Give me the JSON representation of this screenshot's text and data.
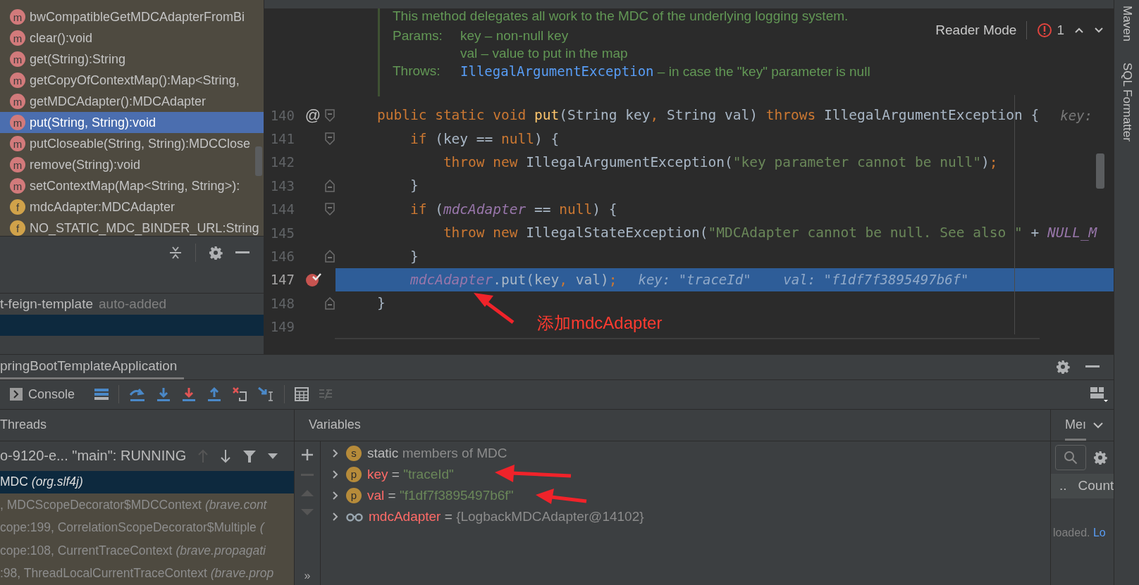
{
  "structure": {
    "items": [
      {
        "kind": "method",
        "badge": "m",
        "label": "bwCompatibleGetMDCAdapterFromBi",
        "selected": false
      },
      {
        "kind": "method",
        "badge": "m",
        "label": "clear():void",
        "selected": false
      },
      {
        "kind": "method",
        "badge": "m",
        "label": "get(String):String",
        "selected": false
      },
      {
        "kind": "method",
        "badge": "m",
        "label": "getCopyOfContextMap():Map<String,",
        "selected": false
      },
      {
        "kind": "method",
        "badge": "m",
        "label": "getMDCAdapter():MDCAdapter",
        "selected": false
      },
      {
        "kind": "method",
        "badge": "m",
        "label": "put(String, String):void",
        "selected": true
      },
      {
        "kind": "method",
        "badge": "m",
        "label": "putCloseable(String, String):MDCClose",
        "selected": false
      },
      {
        "kind": "method",
        "badge": "m",
        "label": "remove(String):void",
        "selected": false
      },
      {
        "kind": "method",
        "badge": "m",
        "label": "setContextMap(Map<String, String>):",
        "selected": false
      },
      {
        "kind": "field",
        "badge": "f",
        "label": "mdcAdapter:MDCAdapter",
        "selected": false
      },
      {
        "kind": "field",
        "badge": "f",
        "label": "NO_STATIC_MDC_BINDER_URL:String",
        "selected": false
      }
    ]
  },
  "dependency": {
    "module": "t-feign-template",
    "note": "auto-added"
  },
  "editor": {
    "doc": {
      "summary": "This method delegates all work to the MDC of the underlying logging system.",
      "params_label": "Params:",
      "params": [
        "key – non-null key",
        "val – value to put in the map"
      ],
      "throws_label": "Throws:",
      "throws_type": "IllegalArgumentException",
      "throws_text": "– in case the \"key\" parameter is null"
    },
    "reader_mode": "Reader Mode",
    "problems": "1",
    "lines": [
      {
        "number": "140",
        "mark": "@",
        "breakpoint": false,
        "current": false,
        "fold_open": true,
        "fold_close": false,
        "tokens": [
          {
            "kind": "kw",
            "s": "    public static void "
          },
          {
            "kind": "method",
            "s": "put"
          },
          {
            "kind": "plain",
            "s": "(String key"
          },
          {
            "kind": "kw",
            "s": ", "
          },
          {
            "kind": "plain",
            "s": "String val) "
          },
          {
            "kind": "kw",
            "s": "throws "
          },
          {
            "kind": "plain",
            "s": "IllegalArgumentException {"
          }
        ],
        "hint": "key:"
      },
      {
        "number": "141",
        "breakpoint": false,
        "current": false,
        "fold_open": true,
        "fold_close": false,
        "tokens": [
          {
            "kind": "kw",
            "s": "        if "
          },
          {
            "kind": "plain",
            "s": "(key == "
          },
          {
            "kind": "kw",
            "s": "null"
          },
          {
            "kind": "plain",
            "s": ") {"
          }
        ]
      },
      {
        "number": "142",
        "breakpoint": false,
        "current": false,
        "fold_open": false,
        "fold_close": false,
        "tokens": [
          {
            "kind": "kw",
            "s": "            throw new "
          },
          {
            "kind": "plain",
            "s": "IllegalArgumentException("
          },
          {
            "kind": "str",
            "s": "\"key parameter cannot be null\""
          },
          {
            "kind": "plain",
            "s": ")"
          },
          {
            "kind": "kw",
            "s": ";"
          }
        ]
      },
      {
        "number": "143",
        "breakpoint": false,
        "current": false,
        "fold_open": false,
        "fold_close": true,
        "tokens": [
          {
            "kind": "plain",
            "s": "        }"
          }
        ]
      },
      {
        "number": "144",
        "breakpoint": false,
        "current": false,
        "fold_open": true,
        "fold_close": false,
        "tokens": [
          {
            "kind": "kw",
            "s": "        if "
          },
          {
            "kind": "plain",
            "s": "("
          },
          {
            "kind": "field",
            "s": "mdcAdapter"
          },
          {
            "kind": "plain",
            "s": " == "
          },
          {
            "kind": "kw",
            "s": "null"
          },
          {
            "kind": "plain",
            "s": ") {"
          }
        ]
      },
      {
        "number": "145",
        "breakpoint": false,
        "current": false,
        "fold_open": false,
        "fold_close": false,
        "tokens": [
          {
            "kind": "kw",
            "s": "            throw new "
          },
          {
            "kind": "plain",
            "s": "IllegalStateException("
          },
          {
            "kind": "str",
            "s": "\"MDCAdapter cannot be null. See also \""
          },
          {
            "kind": "plain",
            "s": " + "
          },
          {
            "kind": "field",
            "s": "NULL_M"
          }
        ]
      },
      {
        "number": "146",
        "breakpoint": false,
        "current": false,
        "fold_open": false,
        "fold_close": true,
        "tokens": [
          {
            "kind": "plain",
            "s": "        }"
          }
        ]
      },
      {
        "number": "147",
        "breakpoint": true,
        "current": true,
        "fold_open": false,
        "fold_close": false,
        "tokens": [
          {
            "kind": "field",
            "s": "        mdcAdapter"
          },
          {
            "kind": "plain",
            "s": ".put(key"
          },
          {
            "kind": "kw",
            "s": ", "
          },
          {
            "kind": "plain",
            "s": "val)"
          },
          {
            "kind": "kw",
            "s": ";"
          }
        ],
        "hint": "key: \"traceId\"    val: \"f1df7f3895497b6f\""
      },
      {
        "number": "148",
        "breakpoint": false,
        "current": false,
        "fold_open": false,
        "fold_close": true,
        "tokens": [
          {
            "kind": "plain",
            "s": "    }"
          }
        ]
      },
      {
        "number": "149",
        "breakpoint": false,
        "current": false,
        "fold_open": false,
        "fold_close": false
      }
    ],
    "annotation": "添加mdcAdapter"
  },
  "debug": {
    "title": "pringBootTemplateApplication",
    "console_tab": "Console",
    "threads": {
      "title": "Threads",
      "thread": "o-9120-e... \"main\": RUNNING",
      "frames": [
        {
          "text": "MDC",
          "detail": "(org.slf4j)",
          "selected": true
        },
        {
          "text": ", MDCScopeDecorator$MDCContext",
          "detail": "(brave.cont",
          "selected": false
        },
        {
          "text": "cope:199, CorrelationScopeDecorator$Multiple",
          "detail": "(",
          "selected": false
        },
        {
          "text": "cope:108, CurrentTraceContext",
          "detail": "(brave.propagati",
          "selected": false
        },
        {
          "text": ":98, ThreadLocalCurrentTraceContext",
          "detail": "(brave.prop",
          "selected": false
        }
      ]
    },
    "variables": {
      "title": "Variables",
      "items": [
        {
          "kind": "static",
          "badge": "s",
          "name": "static",
          "value": "members of MDC"
        },
        {
          "kind": "param",
          "badge": "p",
          "name": "key",
          "operator": "=",
          "value": "\"traceId\""
        },
        {
          "kind": "param",
          "badge": "p",
          "name": "val",
          "operator": "=",
          "value": "\"f1df7f3895497b6f\""
        },
        {
          "kind": "field",
          "name": "mdcAdapter",
          "operator": "=",
          "value": "{LogbackMDCAdapter@14102}"
        }
      ],
      "more": "»"
    },
    "memory": {
      "tab": "Meı",
      "column_prefix": "..",
      "column": "Count",
      "status": "loaded.",
      "link": "Lo"
    }
  },
  "right_strip": [
    "Maven",
    "SQL Formatter"
  ]
}
